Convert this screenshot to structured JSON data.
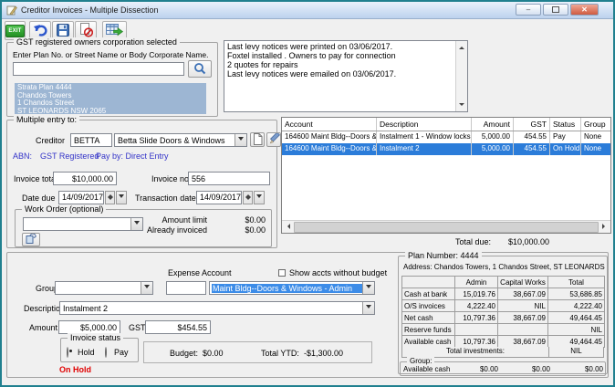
{
  "window": {
    "title": "Creditor Invoices - Multiple Dissection"
  },
  "icons": {
    "app": "document-icon",
    "minimize_glyph": "–",
    "close_glyph": "✕",
    "undo": "curved-left-arrow",
    "save": "floppy-disk",
    "delete": "page-with-no-symbol",
    "export": "grid-with-green-arrow",
    "search": "magnifier",
    "new_creditor": "blank-page",
    "edit_creditor": "pencil",
    "work_order_report": "blue-ledger"
  },
  "toolbar": {
    "exit_label": "EXIT"
  },
  "owners_box": {
    "title": "GST registered owners corporation selected",
    "search_label": "Enter Plan No. or Street Name or Body Corporate Name.",
    "search_value": "",
    "selected_plan": {
      "line1": "Strata Plan 4444",
      "line2": "Chandos Towers",
      "line3": "1 Chandos Street",
      "line4": "ST LEONARDS  NSW  2065"
    }
  },
  "notes": {
    "text": "Last levy notices were printed on 03/06/2017.\nFoxtel installed . Owners to pay for connection\n2 quotes for repairs\nLast levy notices were emailed on 03/06/2017."
  },
  "multiple_entry": {
    "title": "Multiple entry to:",
    "creditor_label": "Creditor",
    "creditor_code": "BETTA",
    "creditor_name": "Betta Slide Doors & Windows",
    "abn_label": "ABN:",
    "gst_registered": "GST Registered",
    "pay_by": "Pay by: Direct Entry",
    "invoice_total_label": "Invoice total",
    "invoice_total": "$10,000.00",
    "invoice_no_label": "Invoice no.",
    "invoice_no": "556",
    "date_due_label": "Date due",
    "date_due": "14/09/2017",
    "transaction_date_label": "Transaction date",
    "transaction_date": "14/09/2017",
    "work_order": {
      "title": "Work Order (optional)",
      "selected_value": "",
      "amount_limit_label": "Amount limit",
      "amount_limit": "$0.00",
      "already_invoiced_label": "Already invoiced",
      "already_invoiced": "$0.00"
    }
  },
  "dissection_grid": {
    "columns": [
      "Account",
      "Description",
      "Amount",
      "GST",
      "Status",
      "Group"
    ],
    "rows": [
      {
        "account": "164600  Maint Bldg--Doors & ...",
        "description": "Instalment 1 - Window locks",
        "amount": "5,000.00",
        "gst": "454.55",
        "status": "Pay",
        "group": "None"
      },
      {
        "account": "164600  Maint Bldg--Doors & ...",
        "description": "Instalment 2",
        "amount": "5,000.00",
        "gst": "454.55",
        "status": "On Hold",
        "group": "None"
      }
    ],
    "total_due_label": "Total due:",
    "total_due": "$10,000.00"
  },
  "entry_form": {
    "group_label": "Group",
    "group_value": "",
    "expense_account_label": "Expense Account",
    "show_accts_label": "Show accts without budget",
    "expense_code_value": "",
    "expense_account_value": "Maint Bldg--Doors & Windows - Admin",
    "description_label": "Description",
    "description_value": "Instalment 2",
    "amount_label": "Amount",
    "amount_value": "$5,000.00",
    "gst_label": "GST",
    "gst_value": "$454.55",
    "invoice_status": {
      "title": "Invoice status",
      "hold_label": "Hold",
      "pay_label": "Pay",
      "selected": "Hold"
    },
    "budget_label": "Budget:",
    "budget_value": "$0.00",
    "total_ytd_label": "Total YTD:",
    "total_ytd_value": "-$1,300.00",
    "status_text": "On Hold"
  },
  "plan_panel": {
    "title": "Plan Number: 4444",
    "address": "Address: Chandos Towers, 1 Chandos Street, ST LEONARDS",
    "columns": [
      "",
      "Admin",
      "Capital Works",
      "Total"
    ],
    "rows": [
      [
        "Cash at bank",
        "15,019.76",
        "38,667.09",
        "53,686.85"
      ],
      [
        "O/S invoices",
        "4,222.40",
        "NIL",
        "4,222.40"
      ],
      [
        "Net cash",
        "10,797.36",
        "38,667.09",
        "49,464.45"
      ],
      [
        "Reserve funds",
        "",
        "",
        "NIL"
      ],
      [
        "Available cash",
        "10,797.36",
        "38,667.09",
        "49,464.45"
      ]
    ],
    "total_investments_label": "Total investments:",
    "total_investments": "NIL",
    "group_box": {
      "title": "Group:",
      "row_label": "Available cash",
      "admin_value": "$0.00",
      "capital_value": "$0.00",
      "total_value": "$0.00"
    }
  },
  "colors": {
    "window_border": "#20808f",
    "selection_blue": "#2b7cd9",
    "combo_selection_blue": "#3c8ce8",
    "owner_list_bg": "#9db6d3",
    "info_blue": "#3232c8",
    "status_red": "#e00000",
    "exit_green": "#2fa02f"
  }
}
